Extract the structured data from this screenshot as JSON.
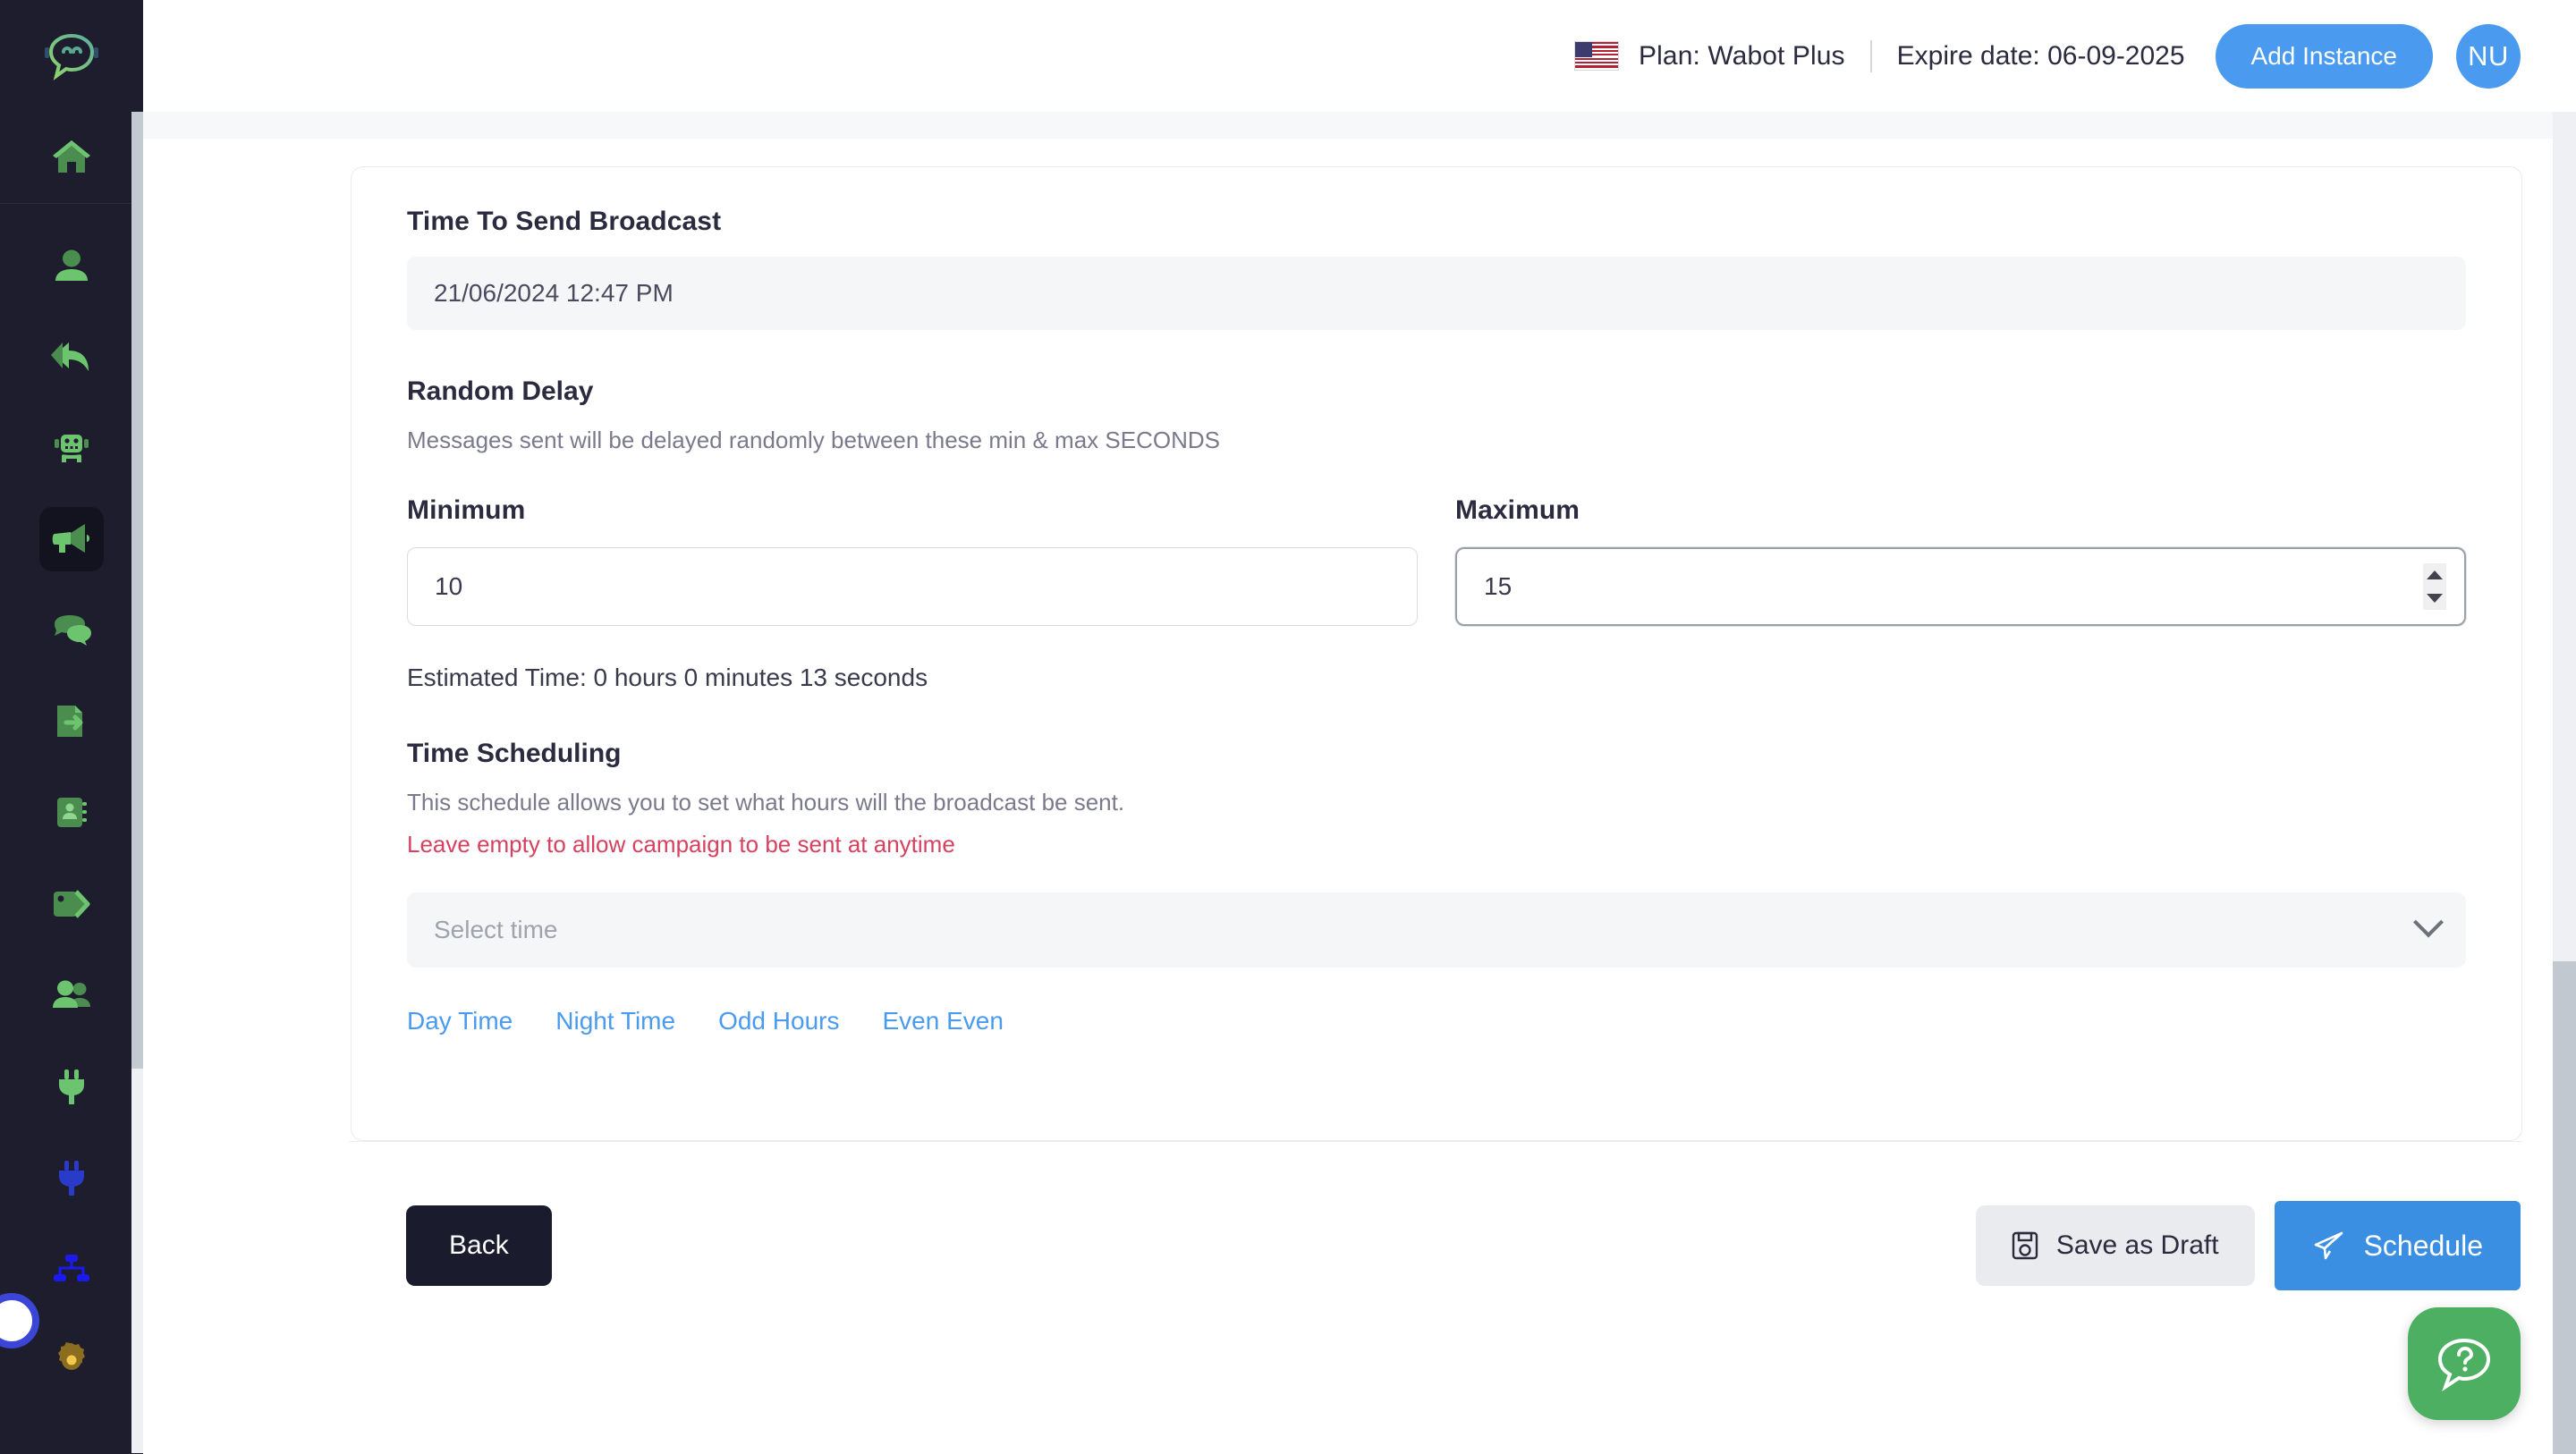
{
  "topbar": {
    "flag_icon": "us-flag-icon",
    "plan_text": "Plan: Wabot Plus",
    "expire_text": "Expire date: 06-09-2025",
    "add_instance_label": "Add Instance",
    "avatar_initials": "NU"
  },
  "sidebar": {
    "logo_icon": "chat-bubble-logo-icon",
    "items": [
      {
        "name": "home",
        "icon": "home-icon",
        "active": false
      },
      {
        "name": "profile",
        "icon": "user-icon",
        "active": false
      },
      {
        "name": "reply",
        "icon": "reply-arrow-icon",
        "active": false
      },
      {
        "name": "chatbot",
        "icon": "robot-icon",
        "active": false
      },
      {
        "name": "broadcast",
        "icon": "megaphone-icon",
        "active": true
      },
      {
        "name": "chats",
        "icon": "chat-bubbles-icon",
        "active": false
      },
      {
        "name": "export",
        "icon": "file-export-icon",
        "active": false
      },
      {
        "name": "contacts",
        "icon": "address-book-icon",
        "active": false
      },
      {
        "name": "tags",
        "icon": "tag-icon",
        "active": false
      },
      {
        "name": "groups",
        "icon": "users-group-icon",
        "active": false
      },
      {
        "name": "integration",
        "icon": "plug-green-icon",
        "active": false
      },
      {
        "name": "api",
        "icon": "plug-blue-icon",
        "active": false
      },
      {
        "name": "webhook",
        "icon": "sitemap-icon",
        "active": false
      },
      {
        "name": "settings",
        "icon": "gear-icon",
        "active": false
      }
    ]
  },
  "form": {
    "time_to_send_label": "Time To Send Broadcast",
    "time_to_send_value": "21/06/2024 12:47 PM",
    "random_delay_title": "Random Delay",
    "random_delay_help": "Messages sent will be delayed randomly between these min & max SECONDS",
    "minimum_label": "Minimum",
    "minimum_value": "10",
    "maximum_label": "Maximum",
    "maximum_value": "15",
    "estimated_time": "Estimated Time: 0 hours 0 minutes 13 seconds",
    "time_scheduling_title": "Time Scheduling",
    "time_scheduling_help": "This schedule allows you to set what hours will the broadcast be sent.",
    "time_scheduling_warning": "Leave empty to allow campaign to be sent at anytime",
    "select_time_placeholder": "Select time",
    "select_chevron_icon": "chevron-down-icon",
    "quick_links": [
      {
        "label": "Day Time"
      },
      {
        "label": "Night Time"
      },
      {
        "label": "Odd Hours"
      },
      {
        "label": "Even Even"
      }
    ]
  },
  "footer": {
    "back_label": "Back",
    "save_draft_label": "Save as Draft",
    "save_draft_icon": "floppy-disk-icon",
    "schedule_label": "Schedule",
    "schedule_icon": "paper-plane-icon"
  },
  "help_widget": {
    "icon": "question-chat-bubble-icon"
  },
  "colors": {
    "accent_blue": "#4a9bf0",
    "schedule_blue": "#3b8fe3",
    "sidebar_dark": "#1d1d2e",
    "back_dark": "#1b1b2e",
    "warning_red": "#d6415f",
    "help_green": "#4caf62",
    "sidebar_icon_green": "#63c768"
  }
}
